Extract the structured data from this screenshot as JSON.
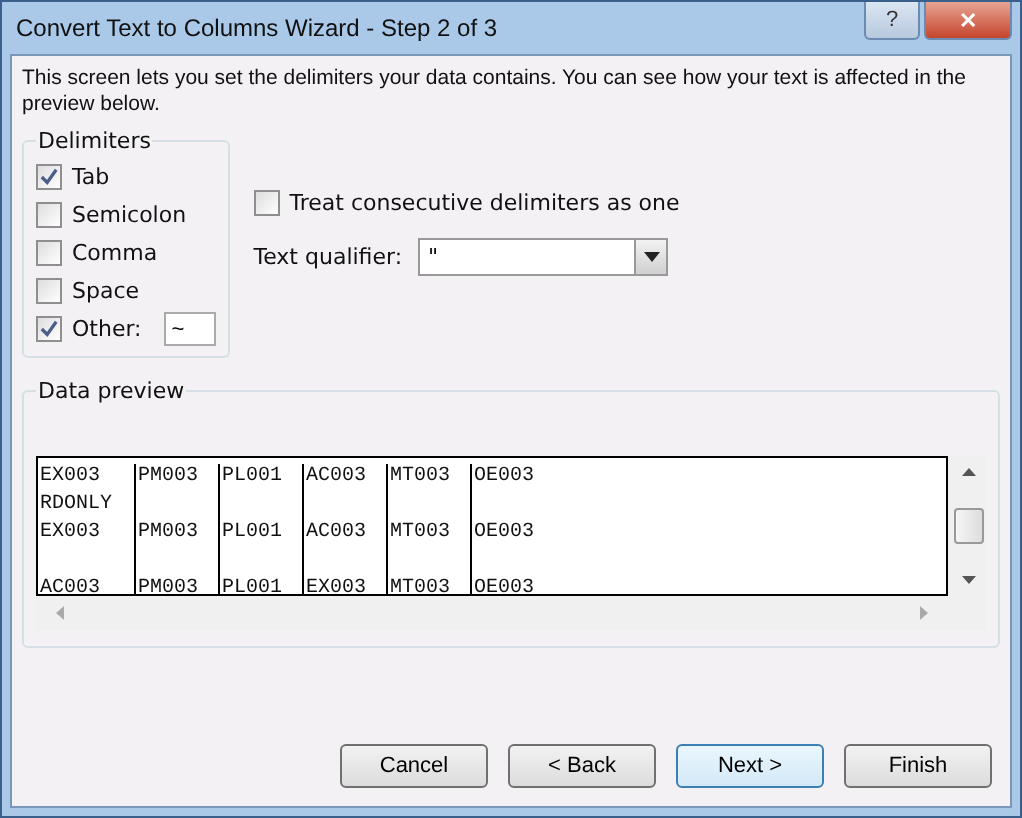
{
  "window": {
    "title": "Convert Text to Columns Wizard - Step 2 of 3",
    "title_buttons": [
      "?",
      "✕"
    ]
  },
  "instructions": "This screen lets you set the delimiters your data contains.  You can see how your text is affected in the preview below.",
  "delimiters": {
    "title": "Delimiters",
    "options": [
      {
        "label": "Tab",
        "checked": true
      },
      {
        "label": "Semicolon",
        "checked": false
      },
      {
        "label": "Comma",
        "checked": false
      },
      {
        "label": "Space",
        "checked": false
      },
      {
        "label": "Other:",
        "checked": true,
        "value": "~"
      }
    ]
  },
  "consecutive": {
    "label": "Treat consecutive delimiters as one",
    "checked": false
  },
  "text_qualifier": {
    "label": "Text qualifier:",
    "value": "\""
  },
  "preview": {
    "title": "Data preview",
    "rows": [
      [
        "EX003",
        "PM003",
        "PL001",
        "AC003",
        "MT003",
        "OE003"
      ],
      [
        "RDONLY"
      ],
      [
        "EX003",
        "PM003",
        "PL001",
        "AC003",
        "MT003",
        "OE003"
      ],
      [],
      [
        "AC003",
        "PM003",
        "PL001",
        "EX003",
        "MT003",
        "OE003"
      ]
    ]
  },
  "buttons": [
    {
      "label": "Cancel",
      "default": false
    },
    {
      "label": "< Back",
      "default": false
    },
    {
      "label": "Next >",
      "default": true
    },
    {
      "label": "Finish",
      "default": false
    }
  ]
}
